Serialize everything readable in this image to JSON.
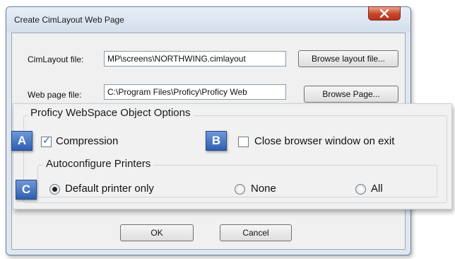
{
  "dialog": {
    "title": "Create CimLayout Web Page"
  },
  "fields": {
    "cimlayout_label": "CimLayout file:",
    "cimlayout_value": "MP\\screens\\NORTHWING.cimlayout",
    "browse_layout_label": "Browse layout file...",
    "webpage_label": "Web page file:",
    "webpage_value": "C:\\Program Files\\Proficy\\Proficy Web",
    "browse_page_label": "Browse Page..."
  },
  "options": {
    "group_title": "Proficy WebSpace Object Options",
    "compression_label": "Compression",
    "compression_checked": true,
    "close_browser_label": "Close browser window on exit",
    "close_browser_checked": false,
    "printers": {
      "group_title": "Autoconfigure Printers",
      "items": [
        {
          "label": "Default printer only",
          "selected": true
        },
        {
          "label": "None",
          "selected": false
        },
        {
          "label": "All",
          "selected": false
        }
      ]
    }
  },
  "callouts": {
    "a": "A",
    "b": "B",
    "c": "C"
  },
  "footer": {
    "ok_label": "OK",
    "cancel_label": "Cancel"
  },
  "colors": {
    "callout_blue": "#3a6bbd",
    "close_red": "#c8442a",
    "window_frame": "#dfe7f1"
  }
}
